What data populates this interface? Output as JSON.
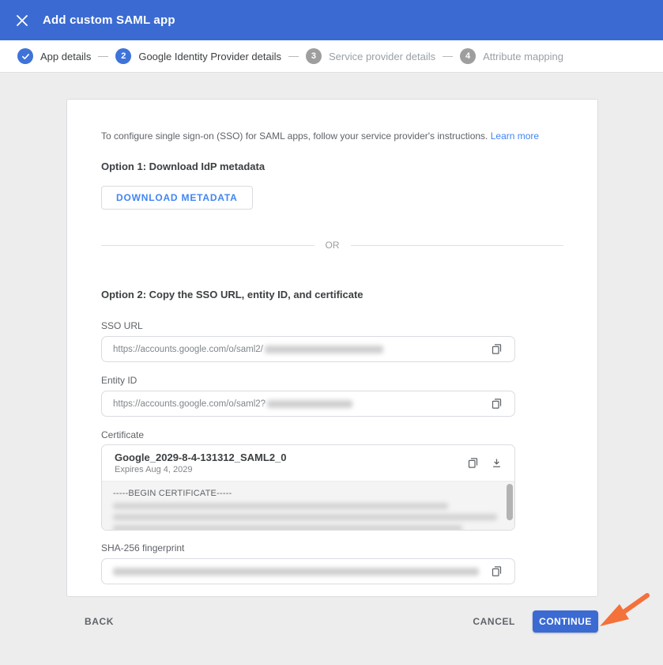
{
  "app": {
    "title": "Add custom SAML app"
  },
  "stepper": {
    "steps": [
      {
        "number": "1",
        "label": "App details",
        "state": "complete"
      },
      {
        "number": "2",
        "label": "Google Identity Provider details",
        "state": "active"
      },
      {
        "number": "3",
        "label": "Service provider details",
        "state": "upcoming"
      },
      {
        "number": "4",
        "label": "Attribute mapping",
        "state": "upcoming"
      }
    ]
  },
  "content": {
    "intro": "To configure single sign-on (SSO) for SAML apps, follow your service provider's instructions.",
    "learn_more_link": "Learn more",
    "option1_heading": "Option 1: Download IdP metadata",
    "download_metadata_button": "DOWNLOAD METADATA",
    "or_divider": "OR",
    "option2_heading": "Option 2: Copy the SSO URL, entity ID, and certificate",
    "sso_url": {
      "label": "SSO URL",
      "value_prefix": "https://accounts.google.com/o/saml2/",
      "redacted": true
    },
    "entity_id": {
      "label": "Entity ID",
      "value_prefix": "https://accounts.google.com/o/saml2?",
      "redacted": true
    },
    "certificate": {
      "label": "Certificate",
      "name": "Google_2029-8-4-131312_SAML2_0",
      "expires": "Expires Aug 4, 2029",
      "body_first_line": "-----BEGIN CERTIFICATE-----",
      "body_redacted": true
    },
    "sha256": {
      "label": "SHA-256 fingerprint",
      "redacted": true
    }
  },
  "footer": {
    "back_button": "BACK",
    "cancel_button": "CANCEL",
    "continue_button": "CONTINUE"
  },
  "icons": {
    "close": "close-icon",
    "check": "check-icon",
    "copy": "copy-icon",
    "download": "download-icon",
    "annotation": "orange-arrow-pointing-to-continue"
  },
  "colors": {
    "header_blue": "#3b6bd2",
    "step_active_blue": "#3e73da",
    "step_inactive_gray": "#9e9e9e",
    "link_blue": "#4285f4",
    "continue_blue": "#3b6bd2",
    "arrow_orange": "#f4713a"
  }
}
